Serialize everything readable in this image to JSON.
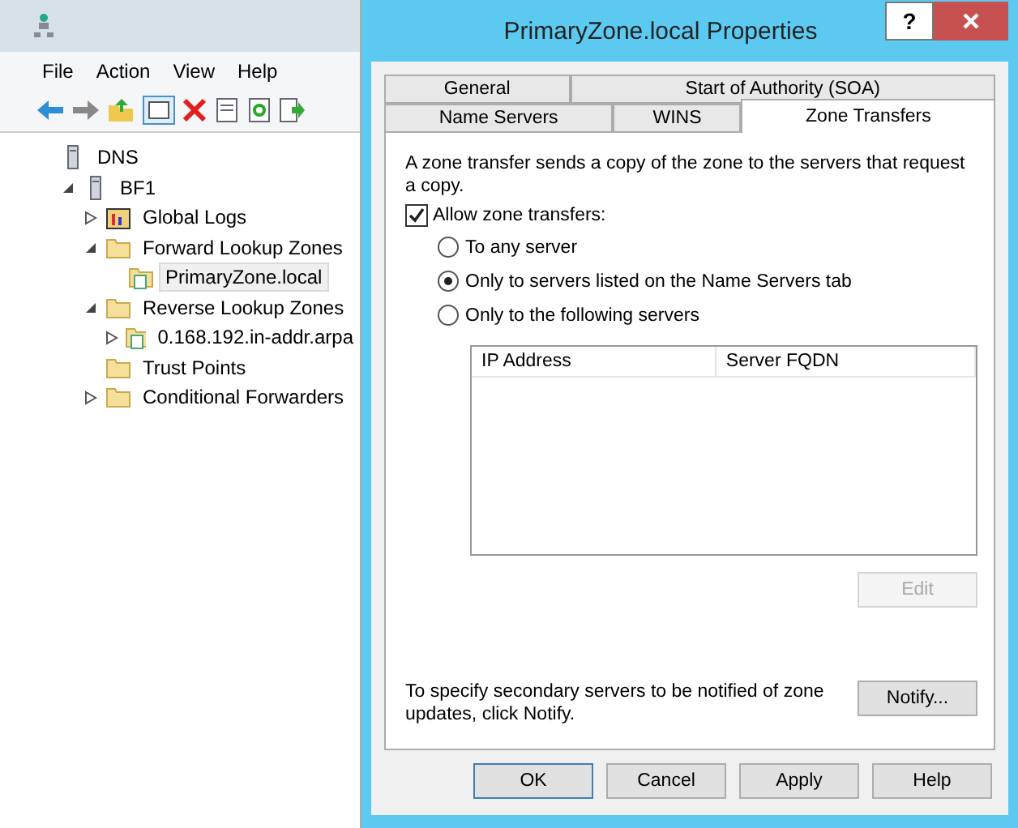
{
  "mmc": {
    "menu": [
      "File",
      "Action",
      "View",
      "Help"
    ],
    "tree": [
      {
        "label": "DNS",
        "kind": "dns",
        "selected": false,
        "children": [
          {
            "label": "BF1",
            "kind": "server",
            "expanded": true,
            "selected": false,
            "children": [
              {
                "label": "Global Logs",
                "kind": "log",
                "expanded": false,
                "selected": false
              },
              {
                "label": "Forward Lookup Zones",
                "kind": "folder",
                "expanded": true,
                "selected": false,
                "children": [
                  {
                    "label": "PrimaryZone.local",
                    "kind": "zone",
                    "selected": true
                  }
                ]
              },
              {
                "label": "Reverse Lookup Zones",
                "kind": "folder",
                "expanded": true,
                "selected": false,
                "children": [
                  {
                    "label": "0.168.192.in-addr.arpa",
                    "kind": "zone",
                    "expanded": false,
                    "selected": false
                  }
                ]
              },
              {
                "label": "Trust Points",
                "kind": "folder",
                "selected": false
              },
              {
                "label": "Conditional Forwarders",
                "kind": "folder",
                "expanded": false,
                "selected": false
              }
            ]
          }
        ]
      }
    ]
  },
  "dialog": {
    "title": "PrimaryZone.local Properties",
    "help_button": "?",
    "tab_rows": [
      [
        {
          "label": "General",
          "selected": false
        },
        {
          "label": "Start of Authority (SOA)",
          "selected": false
        }
      ],
      [
        {
          "label": "Name Servers",
          "selected": false
        },
        {
          "label": "WINS",
          "selected": false
        },
        {
          "label": "Zone Transfers",
          "selected": true
        }
      ]
    ],
    "description": "A zone transfer sends a copy of the zone to the servers that request a copy.",
    "allow": {
      "label": "Allow zone transfers:",
      "checked": true
    },
    "options": [
      {
        "label": "To any server",
        "selected": false
      },
      {
        "label": "Only to servers listed on the Name Servers tab",
        "selected": true
      },
      {
        "label": "Only to the following servers",
        "selected": false
      }
    ],
    "table": {
      "columns": [
        "IP Address",
        "Server FQDN"
      ]
    },
    "edit_button": {
      "label": "Edit",
      "disabled": true
    },
    "notify_text": "To specify secondary servers to be notified of zone updates, click Notify.",
    "notify_button": {
      "label": "Notify...",
      "disabled": false
    },
    "buttons": [
      {
        "label": "OK",
        "default": true
      },
      {
        "label": "Cancel",
        "default": false
      },
      {
        "label": "Apply",
        "default": false
      },
      {
        "label": "Help",
        "default": false
      }
    ]
  }
}
